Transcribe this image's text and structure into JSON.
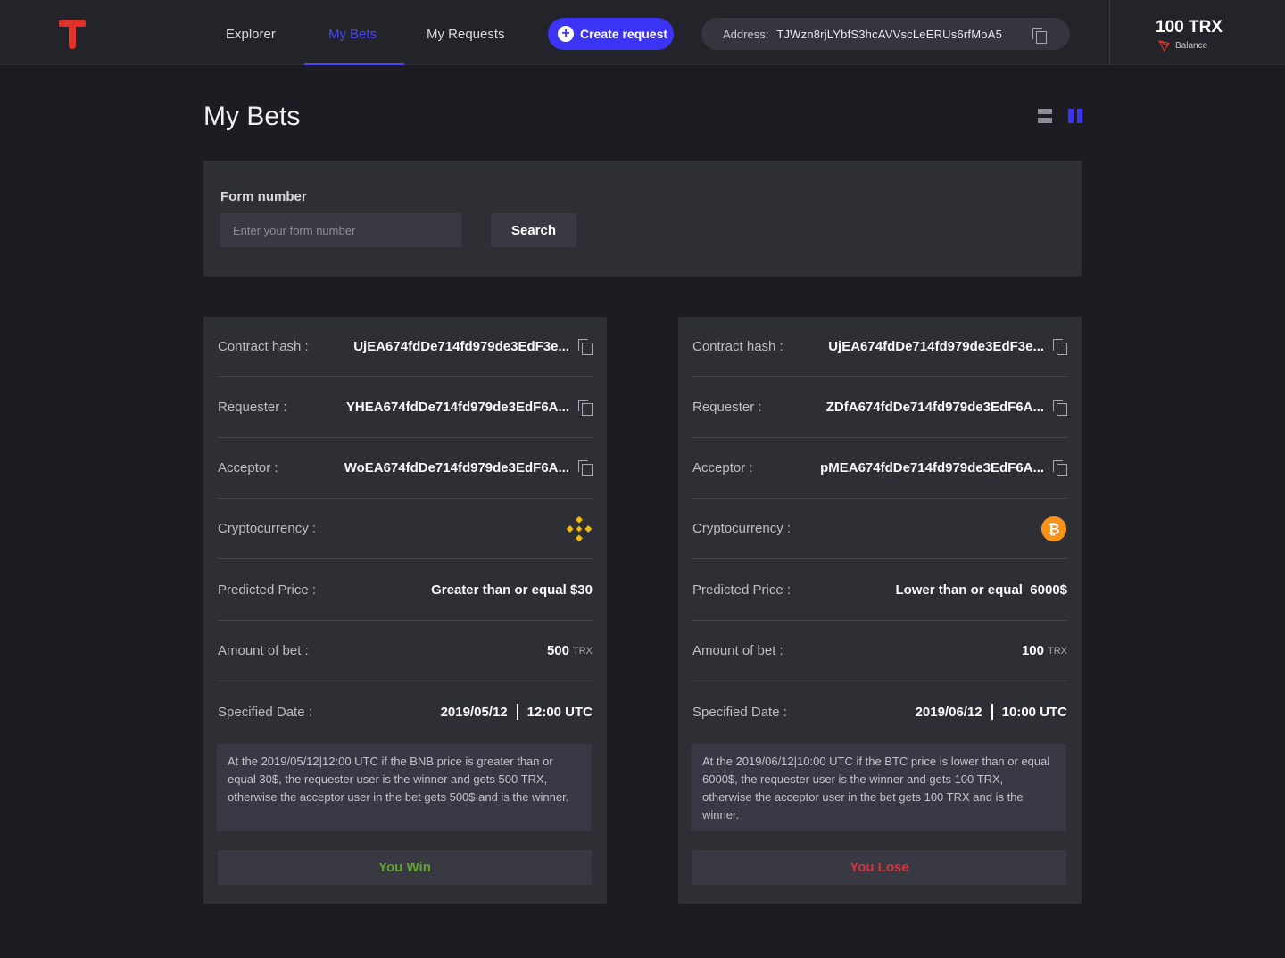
{
  "header": {
    "nav": [
      {
        "label": "Explorer"
      },
      {
        "label": "My Bets"
      },
      {
        "label": "My Requests"
      }
    ],
    "create_label": "Create request",
    "address_label": "Address:",
    "address_value": "TJWzn8rjLYbfS3hcAVVscLeERUs6rfMoA5",
    "balance_amount": "100 TRX",
    "balance_label": "Balance"
  },
  "page": {
    "title": "My Bets"
  },
  "search": {
    "label": "Form number",
    "placeholder": "Enter your form number",
    "button": "Search"
  },
  "labels": {
    "contract_hash": "Contract hash :",
    "requester": "Requester :",
    "acceptor": "Acceptor :",
    "cryptocurrency": "Cryptocurrency :",
    "predicted_price": "Predicted Price :",
    "amount": "Amount of bet :",
    "date": "Specified Date :"
  },
  "cards": [
    {
      "contract_hash": "UjEA674fdDe714fd979de3EdF3e...",
      "requester": "YHEA674fdDe714fd979de3EdF6A...",
      "acceptor": "WoEA674fdDe714fd979de3EdF6A...",
      "crypto_icon": "binance-icon",
      "predicted_price": "Greater than or equal $30",
      "amount": "500",
      "amount_unit": "TRX",
      "date": "2019/05/12",
      "time": "12:00 UTC",
      "description": "At the 2019/05/12|12:00 UTC  if the  BNB price is greater than or equal 30$, the requester user is the winner and gets 500 TRX, otherwise the acceptor user in the bet gets 500$ and  is the winner.",
      "result": "You Win",
      "result_color": "#5fa32c"
    },
    {
      "contract_hash": "UjEA674fdDe714fd979de3EdF3e...",
      "requester": "ZDfA674fdDe714fd979de3EdF6A...",
      "acceptor": "pMEA674fdDe714fd979de3EdF6A...",
      "crypto_icon": "bitcoin-icon",
      "predicted_price": "Lower than or equal  6000$",
      "amount": "100",
      "amount_unit": "TRX",
      "date": "2019/06/12",
      "time": "10:00 UTC",
      "description": "At the 2019/06/12|10:00 UTC  if the  BTC price is lower than or equal 6000$, the requester user is the winner and gets 100 TRX, otherwise the acceptor user in the bet gets 100 TRX and  is the winner.",
      "result": "You Lose",
      "result_color": "#d6323c"
    }
  ],
  "colors": {
    "accent": "#3b34f5",
    "background": "#1d1c22",
    "panel": "#2e2e35",
    "logo_red": "#e0322a"
  }
}
